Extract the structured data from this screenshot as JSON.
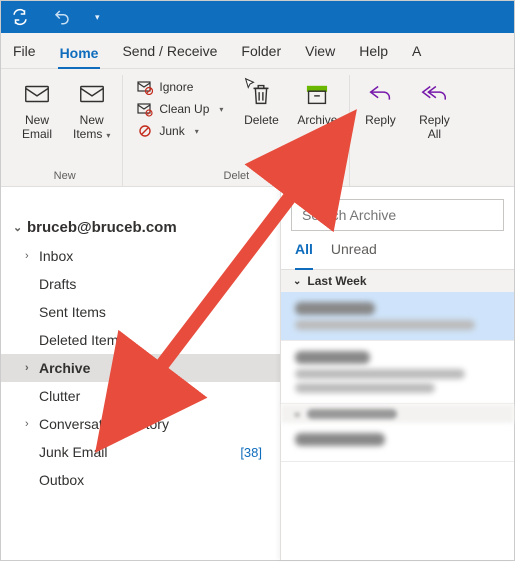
{
  "menubar": {
    "file": "File",
    "home": "Home",
    "sendreceive": "Send / Receive",
    "folder": "Folder",
    "view": "View",
    "help": "Help",
    "account_partial": "A"
  },
  "ribbon": {
    "group_new": "New",
    "new_email": "New\nEmail",
    "new_items": "New\nItems",
    "ignore": "Ignore",
    "cleanup": "Clean Up",
    "junk": "Junk",
    "group_delete": "Delet",
    "delete": "Delete",
    "archive": "Archive",
    "reply": "Reply",
    "reply_all": "Reply\nAll"
  },
  "nav": {
    "account": "bruceb@bruceb.com",
    "inbox": "Inbox",
    "drafts": "Drafts",
    "sent": "Sent Items",
    "deleted": "Deleted Items",
    "archive": "Archive",
    "clutter": "Clutter",
    "convo": "Conversation History",
    "junk": "Junk Email",
    "junk_count": "[38]",
    "outbox": "Outbox"
  },
  "list": {
    "search_placeholder": "Search Archive",
    "filter_all": "All",
    "filter_unread": "Unread",
    "group_lastweek": "Last Week"
  }
}
